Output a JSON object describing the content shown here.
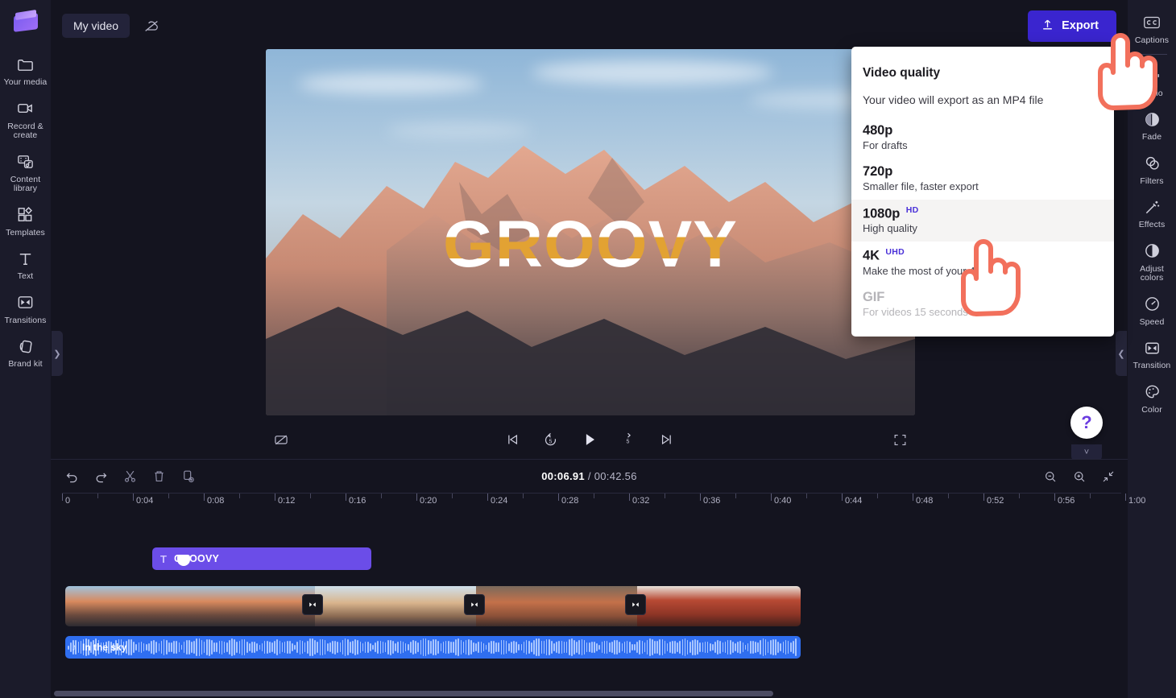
{
  "app": {
    "brand_color": "#6b4de8",
    "accent_color": "#3a25cf",
    "marker_color": "#f2705c"
  },
  "topbar": {
    "project_title": "My video",
    "cloud_icon": "cloud-off-icon",
    "export_label": "Export",
    "export_icon": "upload-arrow-icon"
  },
  "left_sidebar": {
    "items": [
      {
        "label": "Your media",
        "icon": "folder-icon"
      },
      {
        "label": "Record & create",
        "icon": "video-camera-icon"
      },
      {
        "label": "Content library",
        "icon": "media-library-icon"
      },
      {
        "label": "Templates",
        "icon": "templates-grid-icon"
      },
      {
        "label": "Text",
        "icon": "text-t-icon"
      },
      {
        "label": "Transitions",
        "icon": "transitions-icon"
      },
      {
        "label": "Brand kit",
        "icon": "brand-kit-icon"
      }
    ]
  },
  "right_sidebar": {
    "items": [
      {
        "label": "Captions",
        "icon": "closed-captions-icon"
      },
      {
        "label": "Audio",
        "icon": "audio-wave-icon"
      },
      {
        "label": "Fade",
        "icon": "fade-icon"
      },
      {
        "label": "Filters",
        "icon": "filters-circles-icon"
      },
      {
        "label": "Effects",
        "icon": "effects-wand-icon"
      },
      {
        "label": "Adjust colors",
        "icon": "adjust-colors-icon"
      },
      {
        "label": "Speed",
        "icon": "speedometer-icon"
      },
      {
        "label": "Transition",
        "icon": "transition-icon"
      },
      {
        "label": "Color",
        "icon": "color-palette-icon"
      }
    ]
  },
  "export_menu": {
    "title": "Video quality",
    "subtitle": "Your video will export as an MP4 file",
    "options": [
      {
        "name": "480p",
        "badge": "",
        "desc": "For drafts",
        "state": "normal"
      },
      {
        "name": "720p",
        "badge": "",
        "desc": "Smaller file, faster export",
        "state": "normal"
      },
      {
        "name": "1080p",
        "badge": "HD",
        "desc": "High quality",
        "state": "highlighted"
      },
      {
        "name": "4K",
        "badge": "UHD",
        "desc": "Make the most of your 4K media",
        "state": "normal"
      },
      {
        "name": "GIF",
        "badge": "",
        "desc": "For videos 15 seconds or less",
        "state": "disabled"
      }
    ]
  },
  "preview": {
    "overlay_text": "GROOVY",
    "controls": [
      {
        "name": "captions-toggle-off",
        "icon": "captions-off-icon"
      },
      {
        "name": "skip-to-start",
        "icon": "skip-back-icon"
      },
      {
        "name": "rewind-5-seconds",
        "icon": "rewind-5-icon",
        "label": "5"
      },
      {
        "name": "play",
        "icon": "play-icon"
      },
      {
        "name": "forward-5-seconds",
        "icon": "forward-5-icon",
        "label": "5"
      },
      {
        "name": "skip-to-end",
        "icon": "skip-forward-icon"
      },
      {
        "name": "fullscreen",
        "icon": "fullscreen-icon"
      }
    ]
  },
  "help": {
    "label": "?"
  },
  "timeline": {
    "toolbar_left": [
      {
        "name": "undo",
        "icon": "undo-arrow-icon"
      },
      {
        "name": "redo",
        "icon": "redo-arrow-icon"
      },
      {
        "name": "split",
        "icon": "scissors-icon"
      },
      {
        "name": "delete",
        "icon": "trash-icon"
      },
      {
        "name": "duplicate",
        "icon": "duplicate-icon"
      }
    ],
    "toolbar_right": [
      {
        "name": "zoom-out",
        "icon": "magnifier-minus-icon"
      },
      {
        "name": "zoom-in",
        "icon": "magnifier-plus-icon"
      },
      {
        "name": "fit-to-screen",
        "icon": "fit-screen-icon"
      }
    ],
    "current_time": "00:06.91",
    "separator": "/",
    "total_time": "00:42.56",
    "ruler_labels": [
      "0",
      "0:04",
      "0:08",
      "0:12",
      "0:16",
      "0:20",
      "0:24",
      "0:28",
      "0:32",
      "0:36",
      "0:40",
      "0:44",
      "0:48",
      "0:52",
      "0:56",
      "1:00"
    ],
    "text_clip": {
      "icon": "text-t-icon",
      "label": "GROOVY"
    },
    "audio_clip": {
      "icon": "music-note-icon",
      "label": "In the sky"
    },
    "transition_markers": 3
  }
}
